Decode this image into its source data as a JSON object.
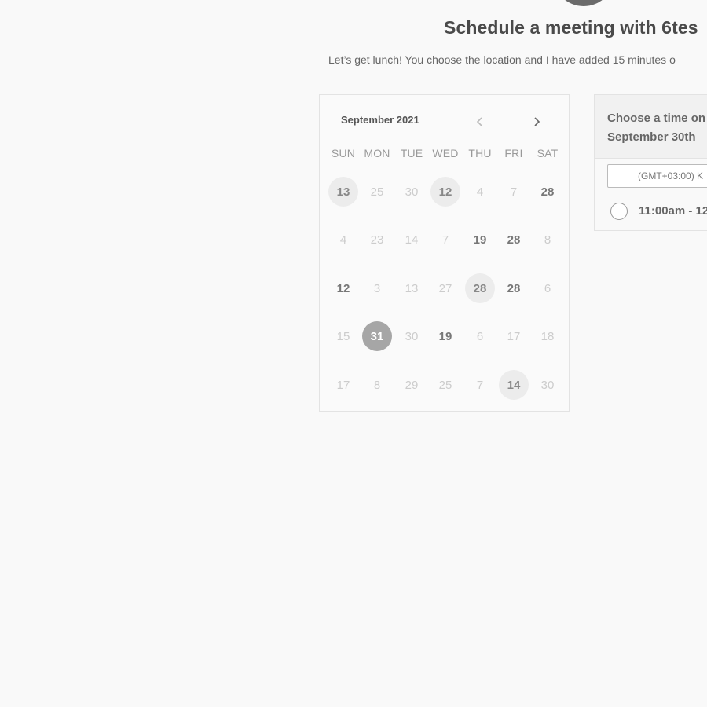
{
  "header": {
    "title": "Schedule a meeting with 6tes",
    "subtitle": "Let’s get lunch! You choose the location and I have added 15 minutes o"
  },
  "calendar": {
    "month_label": "September 2021",
    "weekdays": [
      "SUN",
      "MON",
      "TUE",
      "WED",
      "THU",
      "FRI",
      "SAT"
    ],
    "weeks": [
      [
        {
          "d": "13",
          "s": "avail"
        },
        {
          "d": "25",
          "s": "muted"
        },
        {
          "d": "30",
          "s": "muted"
        },
        {
          "d": "12",
          "s": "avail"
        },
        {
          "d": "4",
          "s": "muted"
        },
        {
          "d": "7",
          "s": "muted"
        },
        {
          "d": "28",
          "s": "dark"
        }
      ],
      [
        {
          "d": "4",
          "s": "muted"
        },
        {
          "d": "23",
          "s": "muted"
        },
        {
          "d": "14",
          "s": "muted"
        },
        {
          "d": "7",
          "s": "muted"
        },
        {
          "d": "19",
          "s": "dark"
        },
        {
          "d": "28",
          "s": "dark"
        },
        {
          "d": "8",
          "s": "muted"
        }
      ],
      [
        {
          "d": "12",
          "s": "dark"
        },
        {
          "d": "3",
          "s": "muted"
        },
        {
          "d": "13",
          "s": "muted"
        },
        {
          "d": "27",
          "s": "muted"
        },
        {
          "d": "28",
          "s": "avail"
        },
        {
          "d": "28",
          "s": "dark"
        },
        {
          "d": "6",
          "s": "muted"
        }
      ],
      [
        {
          "d": "15",
          "s": "muted"
        },
        {
          "d": "31",
          "s": "sel"
        },
        {
          "d": "30",
          "s": "muted"
        },
        {
          "d": "19",
          "s": "dark"
        },
        {
          "d": "6",
          "s": "muted"
        },
        {
          "d": "17",
          "s": "muted"
        },
        {
          "d": "18",
          "s": "muted"
        }
      ],
      [
        {
          "d": "17",
          "s": "muted"
        },
        {
          "d": "8",
          "s": "muted"
        },
        {
          "d": "29",
          "s": "muted"
        },
        {
          "d": "25",
          "s": "muted"
        },
        {
          "d": "7",
          "s": "muted"
        },
        {
          "d": "14",
          "s": "avail"
        },
        {
          "d": "30",
          "s": "muted"
        }
      ]
    ]
  },
  "time_panel": {
    "title_line1": "Choose a time on",
    "title_line2": "September 30th",
    "timezone": "(GMT+03:00) K",
    "slots": [
      {
        "label": "11:00am - 12"
      }
    ]
  }
}
